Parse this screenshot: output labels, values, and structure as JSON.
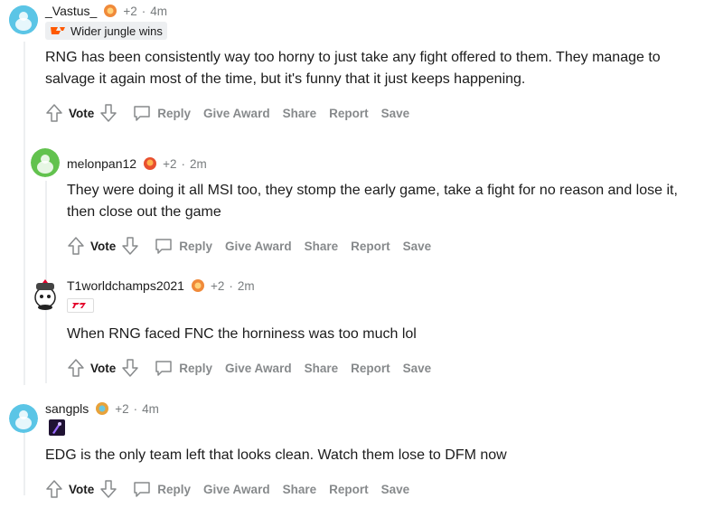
{
  "comments": [
    {
      "username": "_Vastus_",
      "score": "+2",
      "time": "4m",
      "flair": "Wider jungle wins",
      "body": "RNG has been consistently way too horny to just take any fight offered to them. They manage to salvage it again most of the time, but it's funny that it just keeps happening.",
      "avatar_color": "#5bc5e6"
    },
    {
      "username": "melonpan12",
      "score": "+2",
      "time": "2m",
      "body": "They were doing it all MSI too, they stomp the early game, take a fight for no reason and lose it, then close out the game",
      "avatar_color": "#62c24e"
    },
    {
      "username": "T1worldchamps2021",
      "score": "+2",
      "time": "2m",
      "body": "When RNG faced FNC the horniness was too much lol",
      "avatar_color": "#ffffff"
    },
    {
      "username": "sangpls",
      "score": "+2",
      "time": "4m",
      "body": "EDG is the only team left that looks clean. Watch them lose to DFM now",
      "avatar_color": "#5bc5e6"
    }
  ],
  "actions": {
    "vote": "Vote",
    "reply": "Reply",
    "give_award": "Give Award",
    "share": "Share",
    "report": "Report",
    "save": "Save"
  },
  "colors": {
    "meta_gray": "#787c7e",
    "action_gray": "#878a8c",
    "thread_line": "#edeff1"
  }
}
